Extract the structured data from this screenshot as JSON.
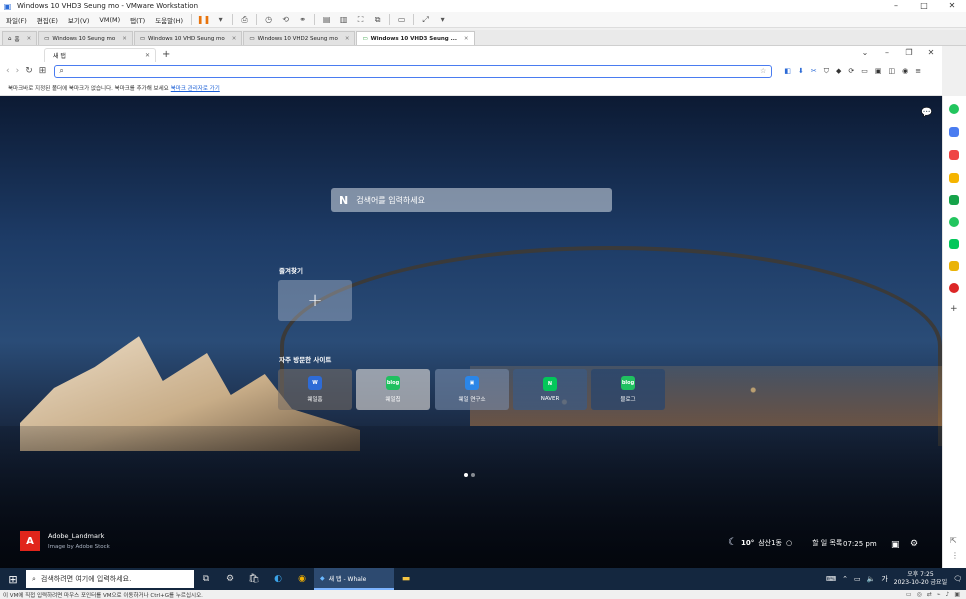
{
  "window": {
    "title": "Windows 10 VHD3 Seung mo - VMware Workstation"
  },
  "menu": [
    "파일(F)",
    "편집(E)",
    "보기(V)",
    "VM(M)",
    "탭(T)",
    "도움말(H)"
  ],
  "vm_tabs": [
    {
      "label": "홈",
      "active": false
    },
    {
      "label": "Windows 10 Seung mo",
      "active": false
    },
    {
      "label": "Windows 10 VHD Seung mo",
      "active": false
    },
    {
      "label": "Windows 10 VHD2 Seung mo",
      "active": false
    },
    {
      "label": "Windows 10 VHD3 Seung ...",
      "active": true
    }
  ],
  "browser": {
    "tab_label": "새 탭",
    "address_placeholder": "",
    "bookmark_bar_text": "북마크바로 지정된 폴더에 북마크가 없습니다. 북마크를 추가해 보세요",
    "bookmark_link": "북마크 관리자로 가기"
  },
  "newtab": {
    "search_placeholder": "검색어를 입력하세요",
    "favorites_title": "즐겨찾기",
    "frequent_title": "자주 방문한 사이트",
    "tiles": [
      {
        "label": "웨일홈",
        "icon_text": "W",
        "icon_color": "#2e6bd6",
        "bg": "rgba(120,110,100,0.55)"
      },
      {
        "label": "웨일칩",
        "icon_text": "blog",
        "icon_color": "#20c060",
        "bg": "rgba(230,225,220,0.75)"
      },
      {
        "label": "웨일 연구소",
        "icon_text": "▣",
        "icon_color": "#2b86e8",
        "bg": "rgba(120,140,170,0.6)"
      },
      {
        "label": "NAVER",
        "icon_text": "N",
        "icon_color": "#03c75a",
        "bg": "rgba(60,90,130,0.75)"
      },
      {
        "label": "블로그",
        "icon_text": "blog",
        "icon_color": "#20c060",
        "bg": "rgba(40,70,110,0.75)"
      }
    ],
    "credit_title": "Adobe_Landmark",
    "credit_sub": "Image by Adobe Stock",
    "weather": {
      "temp": "10°",
      "location": "삼산1동",
      "dust": "할 일 목록"
    },
    "time": "07:25 pm"
  },
  "taskbar": {
    "search_placeholder": "검색하려면 여기에 입력하세요.",
    "active_app": "새 탭 - Whale",
    "time": "오후 7:25",
    "date": "2023-10-20 금요일",
    "ime": "가"
  },
  "statusbar": {
    "text": "이 VM에 직접 입력하려면 마우스 포인터를 VM으로 이동하거나 Ctrl+G를 누르십시오."
  },
  "colors": {
    "accent": "#4a7cf0",
    "taskbar": "#14273f",
    "adobe": "#e1251b"
  }
}
